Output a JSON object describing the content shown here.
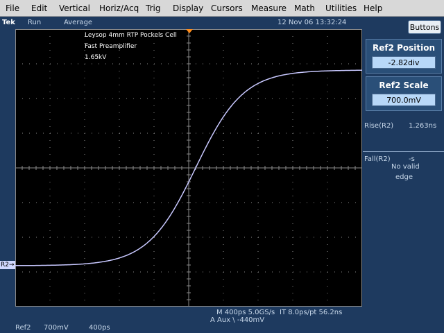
{
  "menu": {
    "items": [
      "File",
      "Edit",
      "Vertical",
      "Horiz/Acq",
      "Trig",
      "Display",
      "Cursors",
      "Measure",
      "Math",
      "Utilities",
      "Help"
    ]
  },
  "status": {
    "brand": "Tek",
    "run_state": "Run",
    "acq_mode": "Average",
    "datetime": "12 Nov 06 13:32:24",
    "buttons_label": "Buttons"
  },
  "annotation": {
    "line1": "Leysop 4mm RTP Pockels Cell",
    "line2": "Fast Preamplifier",
    "line3": "1.65kV"
  },
  "waveform": {
    "label": "R2",
    "color": "#c8c8ff",
    "baseline_div": -2.82,
    "top_div": 2.82,
    "edge_time_div": 0.2
  },
  "panel": {
    "position_title": "Ref2 Position",
    "position_value": "-2.82div",
    "scale_title": "Ref2 Scale",
    "scale_value": "700.0mV",
    "rise_label": "Rise(R2)",
    "rise_value": "1.263ns",
    "fall_label": "Fall(R2)",
    "fall_value": "-s",
    "fall_msg1": "No valid",
    "fall_msg2": "edge"
  },
  "readout": {
    "timebase": "M 400ps 5.0GS/s",
    "interp": "IT 8.0ps/pt 56.2ns",
    "trigger": "A  Aux  \\  -440mV",
    "ref": "Ref2",
    "ref_scale": "700mV",
    "ref_time": "400ps"
  },
  "colors": {
    "trigger_marker": "#ff8c1a",
    "grid": "#8a8a8a",
    "background": "#1e3a5f"
  }
}
